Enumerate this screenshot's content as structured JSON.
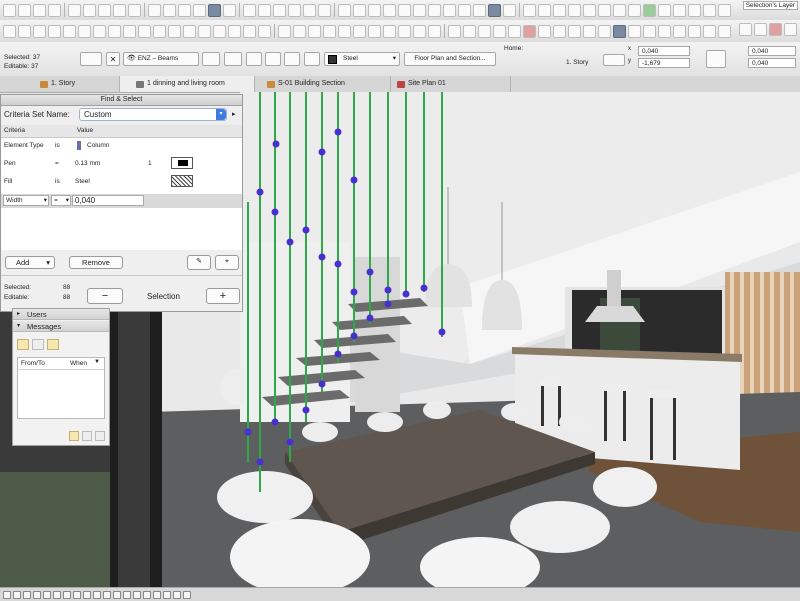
{
  "toolbar": {
    "layers_label": "Selection's Layer"
  },
  "infobox": {
    "selected_label": "Selected: 37",
    "editable_label": "Editable: 37",
    "layer_name": "ENZ – Beams",
    "fill_name": "Steel",
    "view_label": "Floor Plan and Section...",
    "home_label": "Home:",
    "story_value": "1. Story",
    "x_value": "0,040",
    "y_value": "-1,679",
    "right_value": "0,040",
    "right_value2": "0,040"
  },
  "tabs": [
    {
      "label": "1. Story"
    },
    {
      "label": "1 dinning and living room"
    },
    {
      "label": "S-01 Building Section"
    },
    {
      "label": "Site Plan 01"
    }
  ],
  "find_select": {
    "title": "Find & Select",
    "criteria_set_label": "Criteria Set Name:",
    "criteria_set_value": "Custom",
    "col_criteria": "Criteria",
    "col_value": "Value",
    "rows": [
      {
        "criteria": "Element Type",
        "op": "is",
        "value": "Column"
      },
      {
        "criteria": "Pen",
        "op": "=",
        "value": "0.13 mm",
        "extra": "1"
      },
      {
        "criteria": "Fill",
        "op": "is",
        "value": "Steel"
      }
    ],
    "width_criteria": "Width",
    "width_op": "=",
    "width_value": "0,040",
    "add_label": "Add",
    "remove_label": "Remove",
    "selected_label": "Selected:",
    "selected_count": "88",
    "editable_label": "Editable:",
    "editable_count": "88",
    "minus_label": "−",
    "selection_label": "Selection",
    "plus_label": "+"
  },
  "organizer": {
    "users_label": "Users",
    "messages_label": "Messages",
    "col_from": "From/To",
    "col_when": "When"
  },
  "colors": {
    "accent": "#3d7be0",
    "column_green": "#2fa84a",
    "node_blue": "#4a2fd0"
  }
}
